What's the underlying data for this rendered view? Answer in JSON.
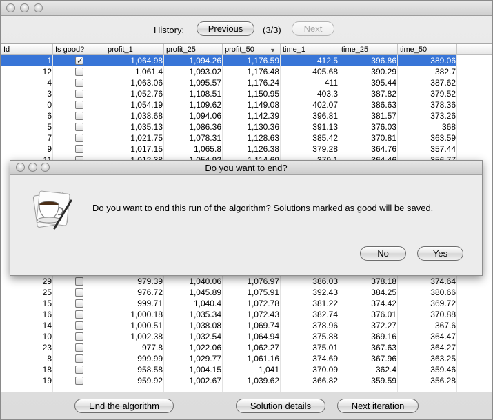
{
  "history": {
    "label": "History:",
    "previous_label": "Previous",
    "page": "(3/3)",
    "next_label": "Next"
  },
  "table": {
    "columns": [
      "Id",
      "Is good?",
      "profit_1",
      "profit_25",
      "profit_50",
      "time_1",
      "time_25",
      "time_50"
    ],
    "sorted_column": "profit_50",
    "rows_top": [
      {
        "id": "1",
        "good": true,
        "p1": "1,064.98",
        "p25": "1,094.26",
        "p50": "1,176.59",
        "t1": "412.5",
        "t25": "396.86",
        "t50": "389.06",
        "selected": true
      },
      {
        "id": "12",
        "good": false,
        "p1": "1,061.4",
        "p25": "1,093.02",
        "p50": "1,176.48",
        "t1": "405.68",
        "t25": "390.29",
        "t50": "382.7"
      },
      {
        "id": "4",
        "good": false,
        "p1": "1,063.06",
        "p25": "1,095.57",
        "p50": "1,176.24",
        "t1": "411",
        "t25": "395.44",
        "t50": "387.62"
      },
      {
        "id": "3",
        "good": false,
        "p1": "1,052.76",
        "p25": "1,108.51",
        "p50": "1,150.95",
        "t1": "403.3",
        "t25": "387.82",
        "t50": "379.52"
      },
      {
        "id": "0",
        "good": false,
        "p1": "1,054.19",
        "p25": "1,109.62",
        "p50": "1,149.08",
        "t1": "402.07",
        "t25": "386.63",
        "t50": "378.36"
      },
      {
        "id": "6",
        "good": false,
        "p1": "1,038.68",
        "p25": "1,094.06",
        "p50": "1,142.39",
        "t1": "396.81",
        "t25": "381.57",
        "t50": "373.26"
      },
      {
        "id": "5",
        "good": false,
        "p1": "1,035.13",
        "p25": "1,086.36",
        "p50": "1,130.36",
        "t1": "391.13",
        "t25": "376.03",
        "t50": "368"
      },
      {
        "id": "7",
        "good": false,
        "p1": "1,021.75",
        "p25": "1,078.31",
        "p50": "1,128.63",
        "t1": "385.42",
        "t25": "370.81",
        "t50": "363.59"
      },
      {
        "id": "9",
        "good": false,
        "p1": "1,017.15",
        "p25": "1,065.8",
        "p50": "1,126.38",
        "t1": "379.28",
        "t25": "364.76",
        "t50": "357.44"
      },
      {
        "id": "11",
        "good": false,
        "p1": "1,012.38",
        "p25": "1,054.92",
        "p50": "1,114.69",
        "t1": "379.1",
        "t25": "364.46",
        "t50": "356.77"
      }
    ],
    "rows_bottom": [
      {
        "id": "29",
        "good": false,
        "p1": "979.39",
        "p25": "1,040.06",
        "p50": "1,076.97",
        "t1": "386.03",
        "t25": "378.18",
        "t50": "374.64"
      },
      {
        "id": "25",
        "good": false,
        "p1": "976.72",
        "p25": "1,045.89",
        "p50": "1,075.91",
        "t1": "392.43",
        "t25": "384.25",
        "t50": "380.66"
      },
      {
        "id": "15",
        "good": false,
        "p1": "999.71",
        "p25": "1,040.4",
        "p50": "1,072.78",
        "t1": "381.22",
        "t25": "374.42",
        "t50": "369.72"
      },
      {
        "id": "16",
        "good": false,
        "p1": "1,000.18",
        "p25": "1,035.34",
        "p50": "1,072.43",
        "t1": "382.74",
        "t25": "376.01",
        "t50": "370.88"
      },
      {
        "id": "14",
        "good": false,
        "p1": "1,000.51",
        "p25": "1,038.08",
        "p50": "1,069.74",
        "t1": "378.96",
        "t25": "372.27",
        "t50": "367.6"
      },
      {
        "id": "10",
        "good": false,
        "p1": "1,002.38",
        "p25": "1,032.54",
        "p50": "1,064.94",
        "t1": "375.88",
        "t25": "369.16",
        "t50": "364.47"
      },
      {
        "id": "23",
        "good": false,
        "p1": "977.8",
        "p25": "1,022.06",
        "p50": "1,062.27",
        "t1": "375.01",
        "t25": "367.63",
        "t50": "364.27"
      },
      {
        "id": "8",
        "good": false,
        "p1": "999.99",
        "p25": "1,029.77",
        "p50": "1,061.16",
        "t1": "374.69",
        "t25": "367.96",
        "t50": "363.25"
      },
      {
        "id": "18",
        "good": false,
        "p1": "958.58",
        "p25": "1,004.15",
        "p50": "1,041",
        "t1": "370.09",
        "t25": "362.4",
        "t50": "359.46"
      },
      {
        "id": "19",
        "good": false,
        "p1": "959.92",
        "p25": "1,002.67",
        "p50": "1,039.62",
        "t1": "366.82",
        "t25": "359.59",
        "t50": "356.28"
      }
    ]
  },
  "footer": {
    "end_label": "End the algorithm",
    "details_label": "Solution details",
    "next_label": "Next iteration"
  },
  "dialog": {
    "title": "Do you want to end?",
    "message": "Do you want to end this run of the algorithm? Solutions marked as good will be saved.",
    "no_label": "No",
    "yes_label": "Yes",
    "icon": "java-coffee-cup-icon"
  },
  "colors": {
    "selection": "#3875d7",
    "window_bg": "#ececec"
  }
}
